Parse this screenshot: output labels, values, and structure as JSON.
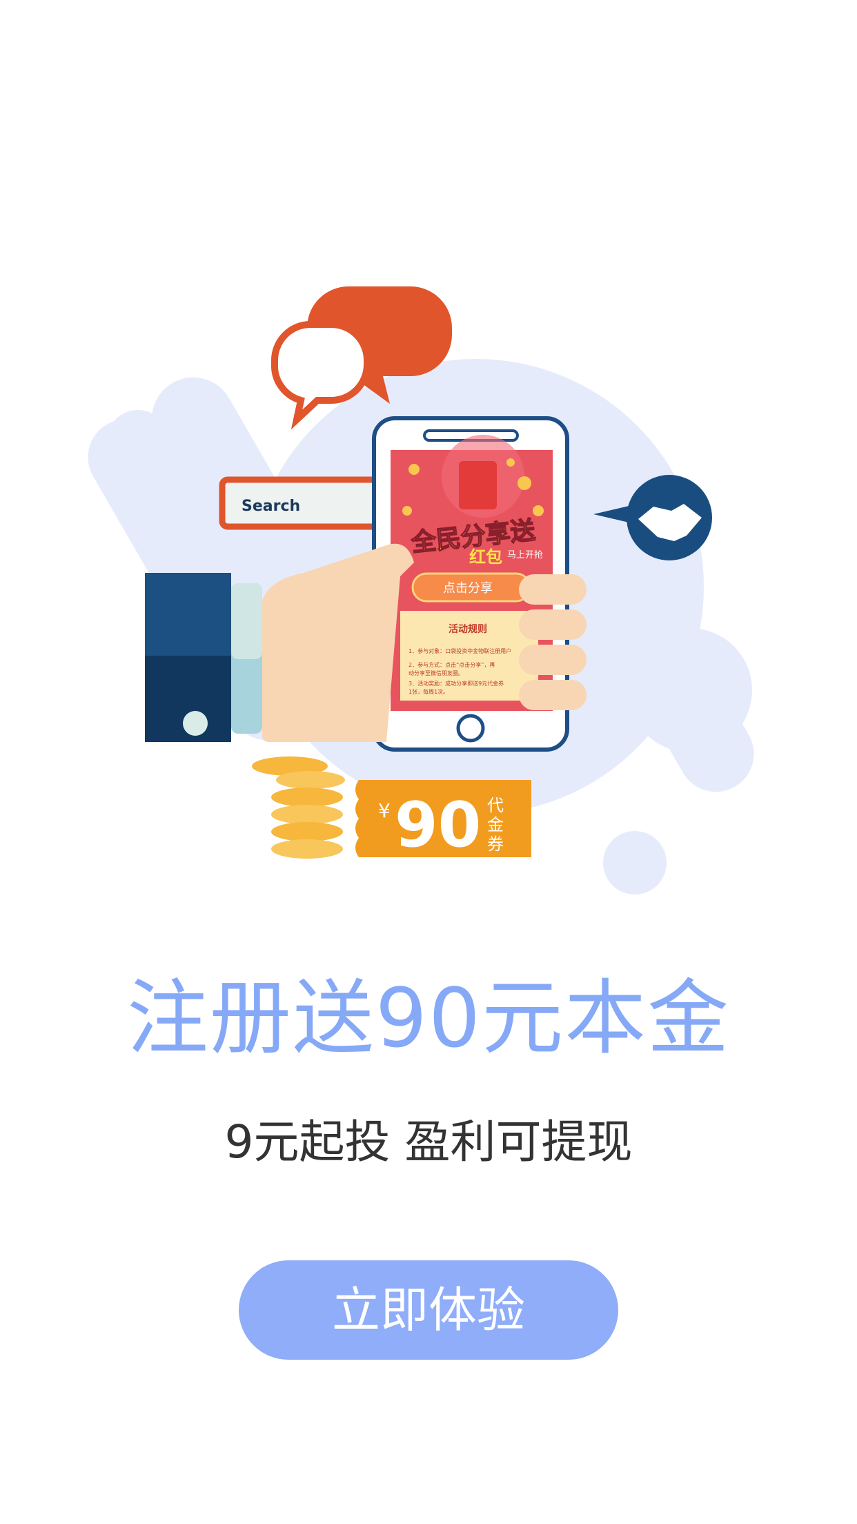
{
  "illustration": {
    "search_label": "Search",
    "promo_title": "全民分享送",
    "promo_subtitle_main": "红包",
    "promo_subtitle_side": "马上开抢",
    "share_button_label": "点击分享",
    "rules_title": "活动规则",
    "rules_lines": [
      "1．参与对象：口袋投资中金物联注册用户",
      "2．参与方式：点击“点击分享”，再",
      "动分享至微信朋友圈。",
      "3．活动奖励：成功分享即送9元代金券",
      "1张，每周1次。"
    ],
    "coupon_currency": "¥",
    "coupon_amount": "90",
    "coupon_label_chars": [
      "代",
      "金",
      "券"
    ],
    "colors": {
      "bg_blob": "#e5ebfb",
      "speech_orange": "#e0552b",
      "phone_outline": "#1e4e86",
      "cuff_dark": "#11375e",
      "skin": "#f8d6b3",
      "coin_gold": "#f6b73c",
      "coupon_orange": "#f29c1f",
      "handshake_navy": "#1a4d7f"
    }
  },
  "headline": "注册送90元本金",
  "subheadline": "9元起投 盈利可提现",
  "cta_button_label": "立即体验",
  "colors": {
    "headline": "#86a9f7",
    "cta_bg": "#8fadf8",
    "subheadline": "#333333"
  }
}
